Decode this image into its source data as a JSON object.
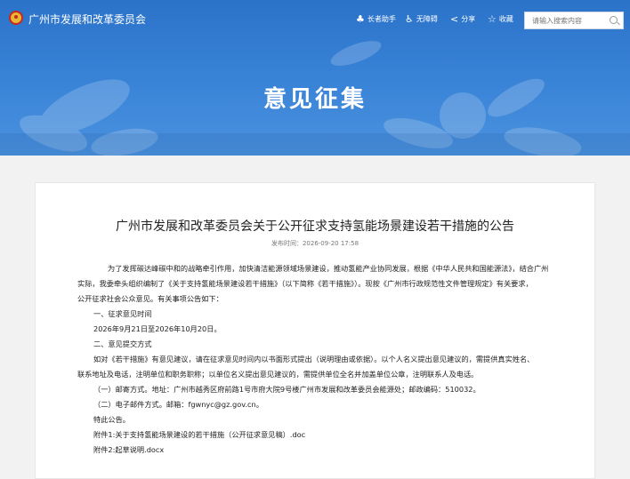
{
  "header": {
    "site_name": "广州市发展和改革委员会",
    "tools": [
      {
        "icon": "elder-assist-icon",
        "glyph": "♣",
        "label": "长者助手"
      },
      {
        "icon": "accessibility-icon",
        "glyph": "♿",
        "label": "无障碍"
      },
      {
        "icon": "share-icon",
        "glyph": "<",
        "label": "分享"
      },
      {
        "icon": "favorite-icon",
        "glyph": "☆",
        "label": "收藏"
      }
    ],
    "search_placeholder": "请输入搜索内容"
  },
  "banner": {
    "title": "意见征集"
  },
  "article": {
    "title": "广州市发展和改革委员会关于公开征求支持氢能场景建设若干措施的公告",
    "publish_time": "发布时间：2026-09-20 17:58",
    "paragraphs": [
      "为了发挥碳达峰碳中和的战略牵引作用，加快清洁能源领域场景建设，推动氢能产业协同发展，根据《中华人民共和国能源法》，结合广州",
      "实际，我委牵头组织编制了《关于支持氢能场景建设若干措施》（以下简称《若干措施》）。现按《广州市行政规范性文件管理规定》有关要求，",
      "公开征求社会公众意见。有关事项公告如下：",
      "一、征求意见时间",
      "2026年9月21日至2026年10月20日。",
      "二、意见提交方式",
      "如对《若干措施》有意见建议，请在征求意见时间内以书面形式提出（说明理由或依据）。以个人名义提出意见建议的，需提供真实姓名、",
      "联系地址及电话，注明单位和职务职称；以单位名义提出意见建议的，需提供单位全名并加盖单位公章，注明联系人及电话。",
      "（一）邮寄方式。地址：广州市越秀区府前路1号市府大院9号楼广州市发展和改革委员会能源处；邮政编码：510032。",
      "（二）电子邮件方式。邮箱：fgwnyc@gz.gov.cn。",
      "特此公告。",
      "附件1:关于支持氢能场景建设的若干措施（公开征求意见稿）.doc",
      "附件2:起草说明.docx"
    ]
  },
  "colors": {
    "banner_blue": "#3a84d8",
    "page_bg": "#f2f2f2"
  }
}
